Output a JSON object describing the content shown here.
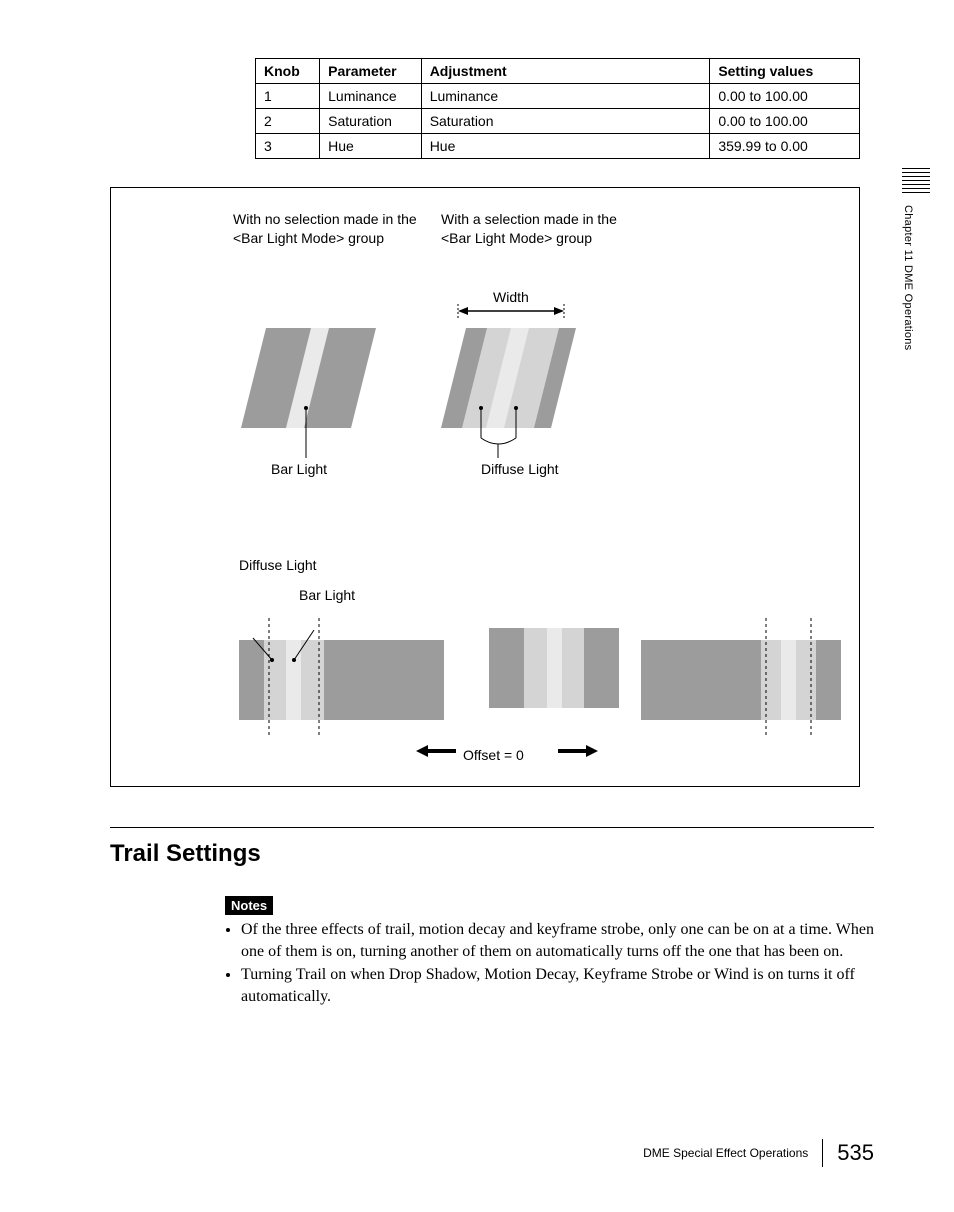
{
  "table": {
    "headers": [
      "Knob",
      "Parameter",
      "Adjustment",
      "Setting values"
    ],
    "rows": [
      [
        "1",
        "Luminance",
        "Luminance",
        "0.00 to 100.00"
      ],
      [
        "2",
        "Saturation",
        "Saturation",
        "0.00 to 100.00"
      ],
      [
        "3",
        "Hue",
        "Hue",
        "359.99 to 0.00"
      ]
    ]
  },
  "diagram": {
    "noSelectionLabel": "With no selection made in the <Bar Light Mode> group",
    "withSelectionLabel": "With a selection made in the <Bar Light Mode> group",
    "widthLabel": "Width",
    "barLightCaption": "Bar Light",
    "diffuseLightCaption": "Diffuse Light",
    "diffuseLightLabel": "Diffuse Light",
    "barLightLabel": "Bar Light",
    "offsetLabel": "Offset = 0"
  },
  "section": {
    "heading": "Trail Settings",
    "notesBadge": "Notes",
    "bullets": [
      "Of the three effects of trail, motion decay and keyframe strobe, only one can be on at a time. When one of them is on, turning another of them on automatically turns off the one that has been on.",
      "Turning Trail on when Drop Shadow, Motion Decay, Keyframe Strobe or Wind is on turns it off automatically."
    ]
  },
  "sidebar": {
    "chapter": "Chapter 11   DME Operations"
  },
  "footer": {
    "text": "DME Special Effect Operations",
    "page": "535"
  }
}
